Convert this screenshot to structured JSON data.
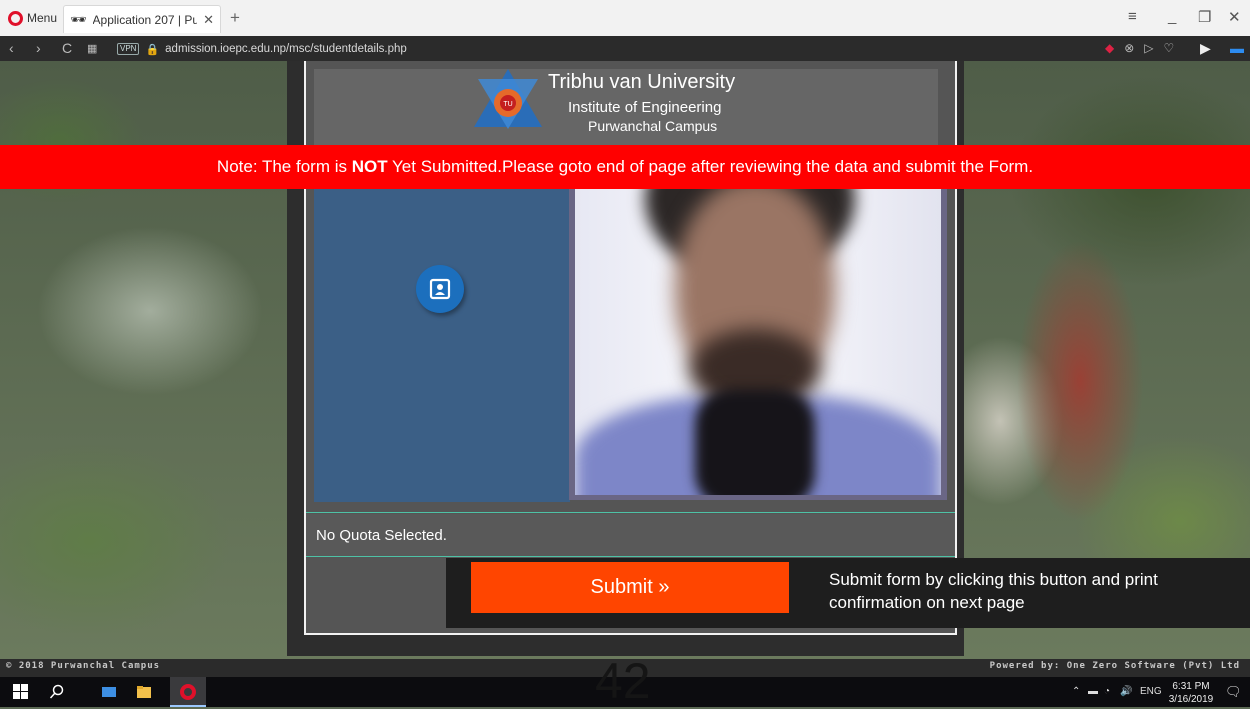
{
  "browser": {
    "menu_label": "Menu",
    "tab_title": "Application 207 | Pu",
    "new_tab": "+",
    "url": "admission.ioepc.edu.np/msc/studentdetails.php",
    "vpn_label": "VPN"
  },
  "header": {
    "university": "Tribhu van University",
    "institute": "Institute of Engineering",
    "campus": "Purwanchal Campus"
  },
  "notice": {
    "prefix": "Note: The form is ",
    "emphasis": "NOT",
    "suffix": " Yet Submitted.Please goto end of page after reviewing the data and submit the Form."
  },
  "quota_text": "No Quota Selected.",
  "submit": {
    "label": "Submit »",
    "hint": "Submit form by clicking this button and print confirmation on next page"
  },
  "footer": {
    "left": "© 2018 Purwanchal Campus",
    "right": "Powered by: One Zero Software (Pvt) Ltd"
  },
  "overlay_number": "42",
  "taskbar": {
    "language": "ENG",
    "time": "6:31 PM",
    "date": "3/16/2019"
  },
  "colors": {
    "notice_bg": "#ff0000",
    "submit_bg": "#ff4500",
    "signature_panel": "#3b5f86",
    "divider": "#4ec2a6"
  }
}
